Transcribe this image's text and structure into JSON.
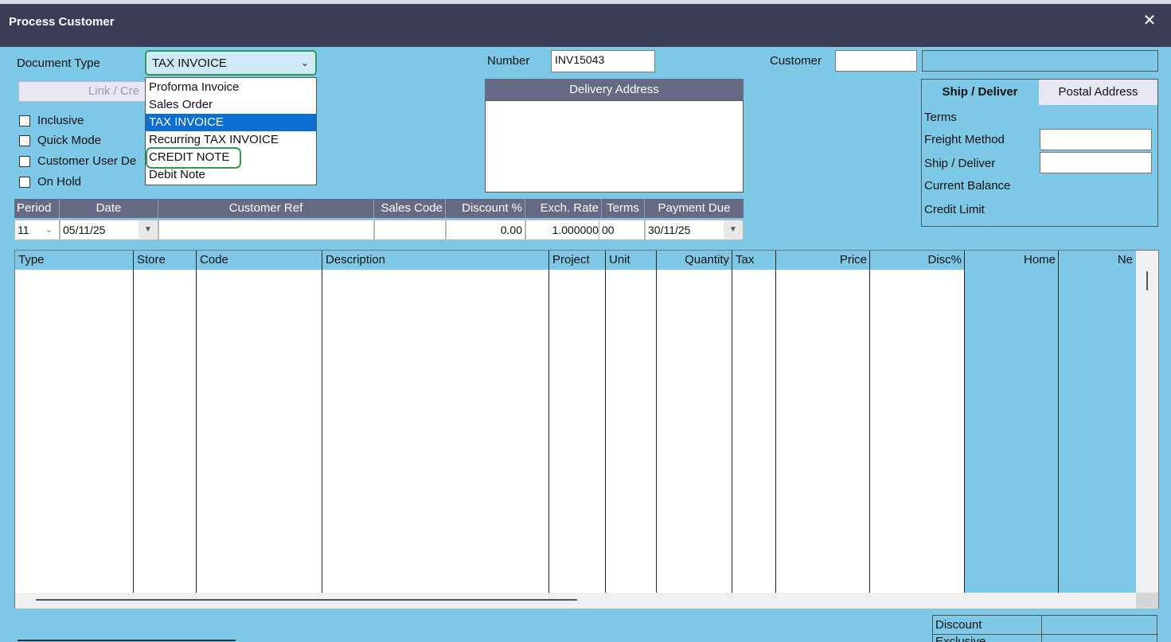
{
  "window": {
    "title": "Process Customer",
    "close_label": "✕"
  },
  "header": {
    "document_type_label": "Document Type",
    "document_type_value": "TAX INVOICE",
    "number_label": "Number",
    "number_value": "INV15043",
    "customer_label": "Customer",
    "customer_value": "",
    "customer_name_value": "",
    "link_button_label": "Link / Cre"
  },
  "dropdown": {
    "options": [
      "Proforma Invoice",
      "Sales Order",
      "TAX INVOICE",
      "Recurring TAX INVOICE",
      "CREDIT NOTE",
      "Debit Note"
    ],
    "selected": "TAX INVOICE"
  },
  "options": {
    "inclusive": "Inclusive",
    "quick_mode": "Quick Mode",
    "customer_user": "Customer User De",
    "on_hold": "On Hold"
  },
  "delivery_address": {
    "title": "Delivery Address"
  },
  "customer_panel": {
    "tab_ship": "Ship / Deliver",
    "tab_postal": "Postal Address",
    "terms": "Terms",
    "freight_method": "Freight Method",
    "ship_deliver": "Ship / Deliver",
    "current_balance": "Current Balance",
    "credit_limit": "Credit Limit"
  },
  "doc_grid": {
    "headers": [
      "Period",
      "Date",
      "Customer Ref",
      "Sales Code",
      "Discount %",
      "Exch. Rate",
      "Terms",
      "Payment Due"
    ],
    "period": "11",
    "date": "05/11/25",
    "customer_ref": "",
    "sales_code": "",
    "discount": "0.00",
    "exch_rate": "1.000000",
    "terms": "00",
    "payment_due": "30/11/25"
  },
  "lines_grid": {
    "columns": [
      "Type",
      "Store",
      "Code",
      "Description",
      "Project",
      "Unit",
      "Quantity",
      "Tax",
      "Price",
      "Disc%",
      "Home",
      "Ne"
    ]
  },
  "totals": {
    "discount": "Discount",
    "next_partial": "Exclusive"
  },
  "colors": {
    "background": "#7cc8e6",
    "titlebar": "#3a3d55",
    "header_bg": "#676a85",
    "selected": "#0a6fd1",
    "highlight": "#2e9a58"
  }
}
